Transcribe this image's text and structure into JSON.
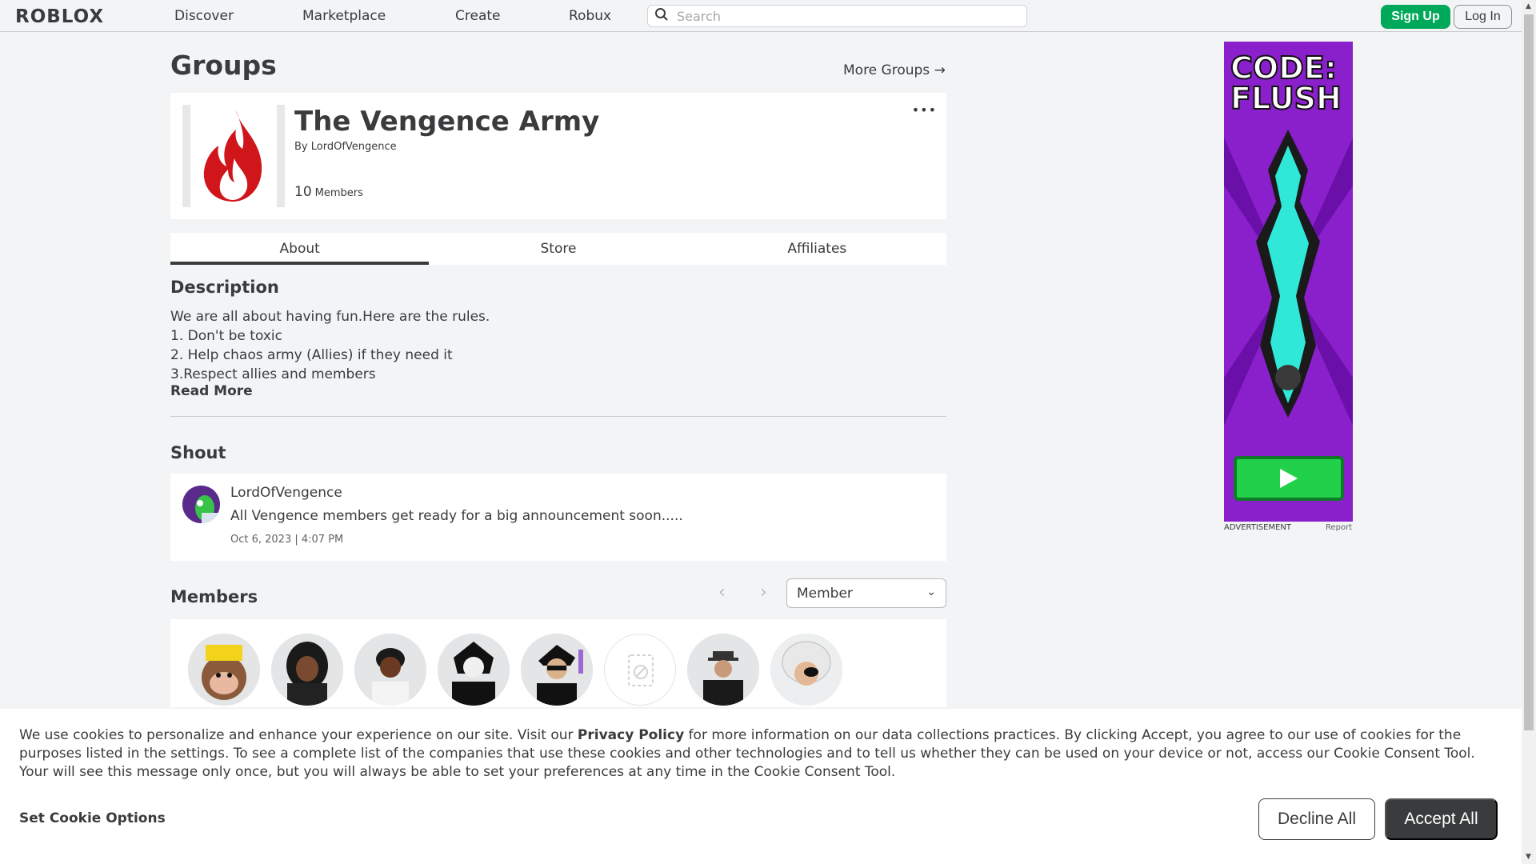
{
  "nav": {
    "logo": "ROBLOX",
    "links": [
      "Discover",
      "Marketplace",
      "Create",
      "Robux"
    ],
    "search_placeholder": "Search",
    "signup": "Sign Up",
    "login": "Log In"
  },
  "header": {
    "title": "Groups",
    "more_groups": "More Groups →"
  },
  "group": {
    "name": "The Vengence Army",
    "by_label": "By",
    "owner": "LordOfVengence",
    "member_count": "10",
    "members_label": "Members",
    "more_icon": "more-dots-icon"
  },
  "tabs": [
    {
      "label": "About",
      "active": true
    },
    {
      "label": "Store",
      "active": false
    },
    {
      "label": "Affiliates",
      "active": false
    }
  ],
  "description": {
    "heading": "Description",
    "lines": [
      "We are all about having fun.Here are the rules.",
      "1. Don't be toxic",
      "2. Help chaos army (Allies) if they need it",
      "3.Respect allies and members"
    ],
    "read_more": "Read More"
  },
  "shout": {
    "heading": "Shout",
    "user": "LordOfVengence",
    "message": "All Vengence members get ready for a big announcement soon.....",
    "time": "Oct 6, 2023 | 4:07 PM"
  },
  "members": {
    "heading": "Members",
    "role": "Member",
    "avatars": [
      "member-1",
      "member-2",
      "member-3",
      "member-4",
      "member-5",
      "member-6",
      "member-7",
      "member-8"
    ]
  },
  "ad": {
    "title_line1": "CODE:",
    "title_line2": "FLUSH",
    "label": "ADVERTISEMENT",
    "report": "Report"
  },
  "cookie": {
    "text_pre": "We use cookies to personalize and enhance your experience on our site. Visit our ",
    "privacy": "Privacy Policy",
    "text_post": " for more information on our data collections practices. By clicking Accept, you agree to our use of cookies for the purposes listed in the settings. To see a complete list of the companies that use these cookies and other technologies and to tell us whether they can be used on your device or not, access our Cookie Consent Tool. Your will see this message only once, but you will always be able to set your preferences at any time in the Cookie Consent Tool.",
    "options": "Set Cookie Options",
    "decline": "Decline All",
    "accept": "Accept All"
  },
  "colors": {
    "accent_green": "#00a85a",
    "text": "#393b3d",
    "bg": "#f2f4f5",
    "flame_red": "#d0161b"
  }
}
